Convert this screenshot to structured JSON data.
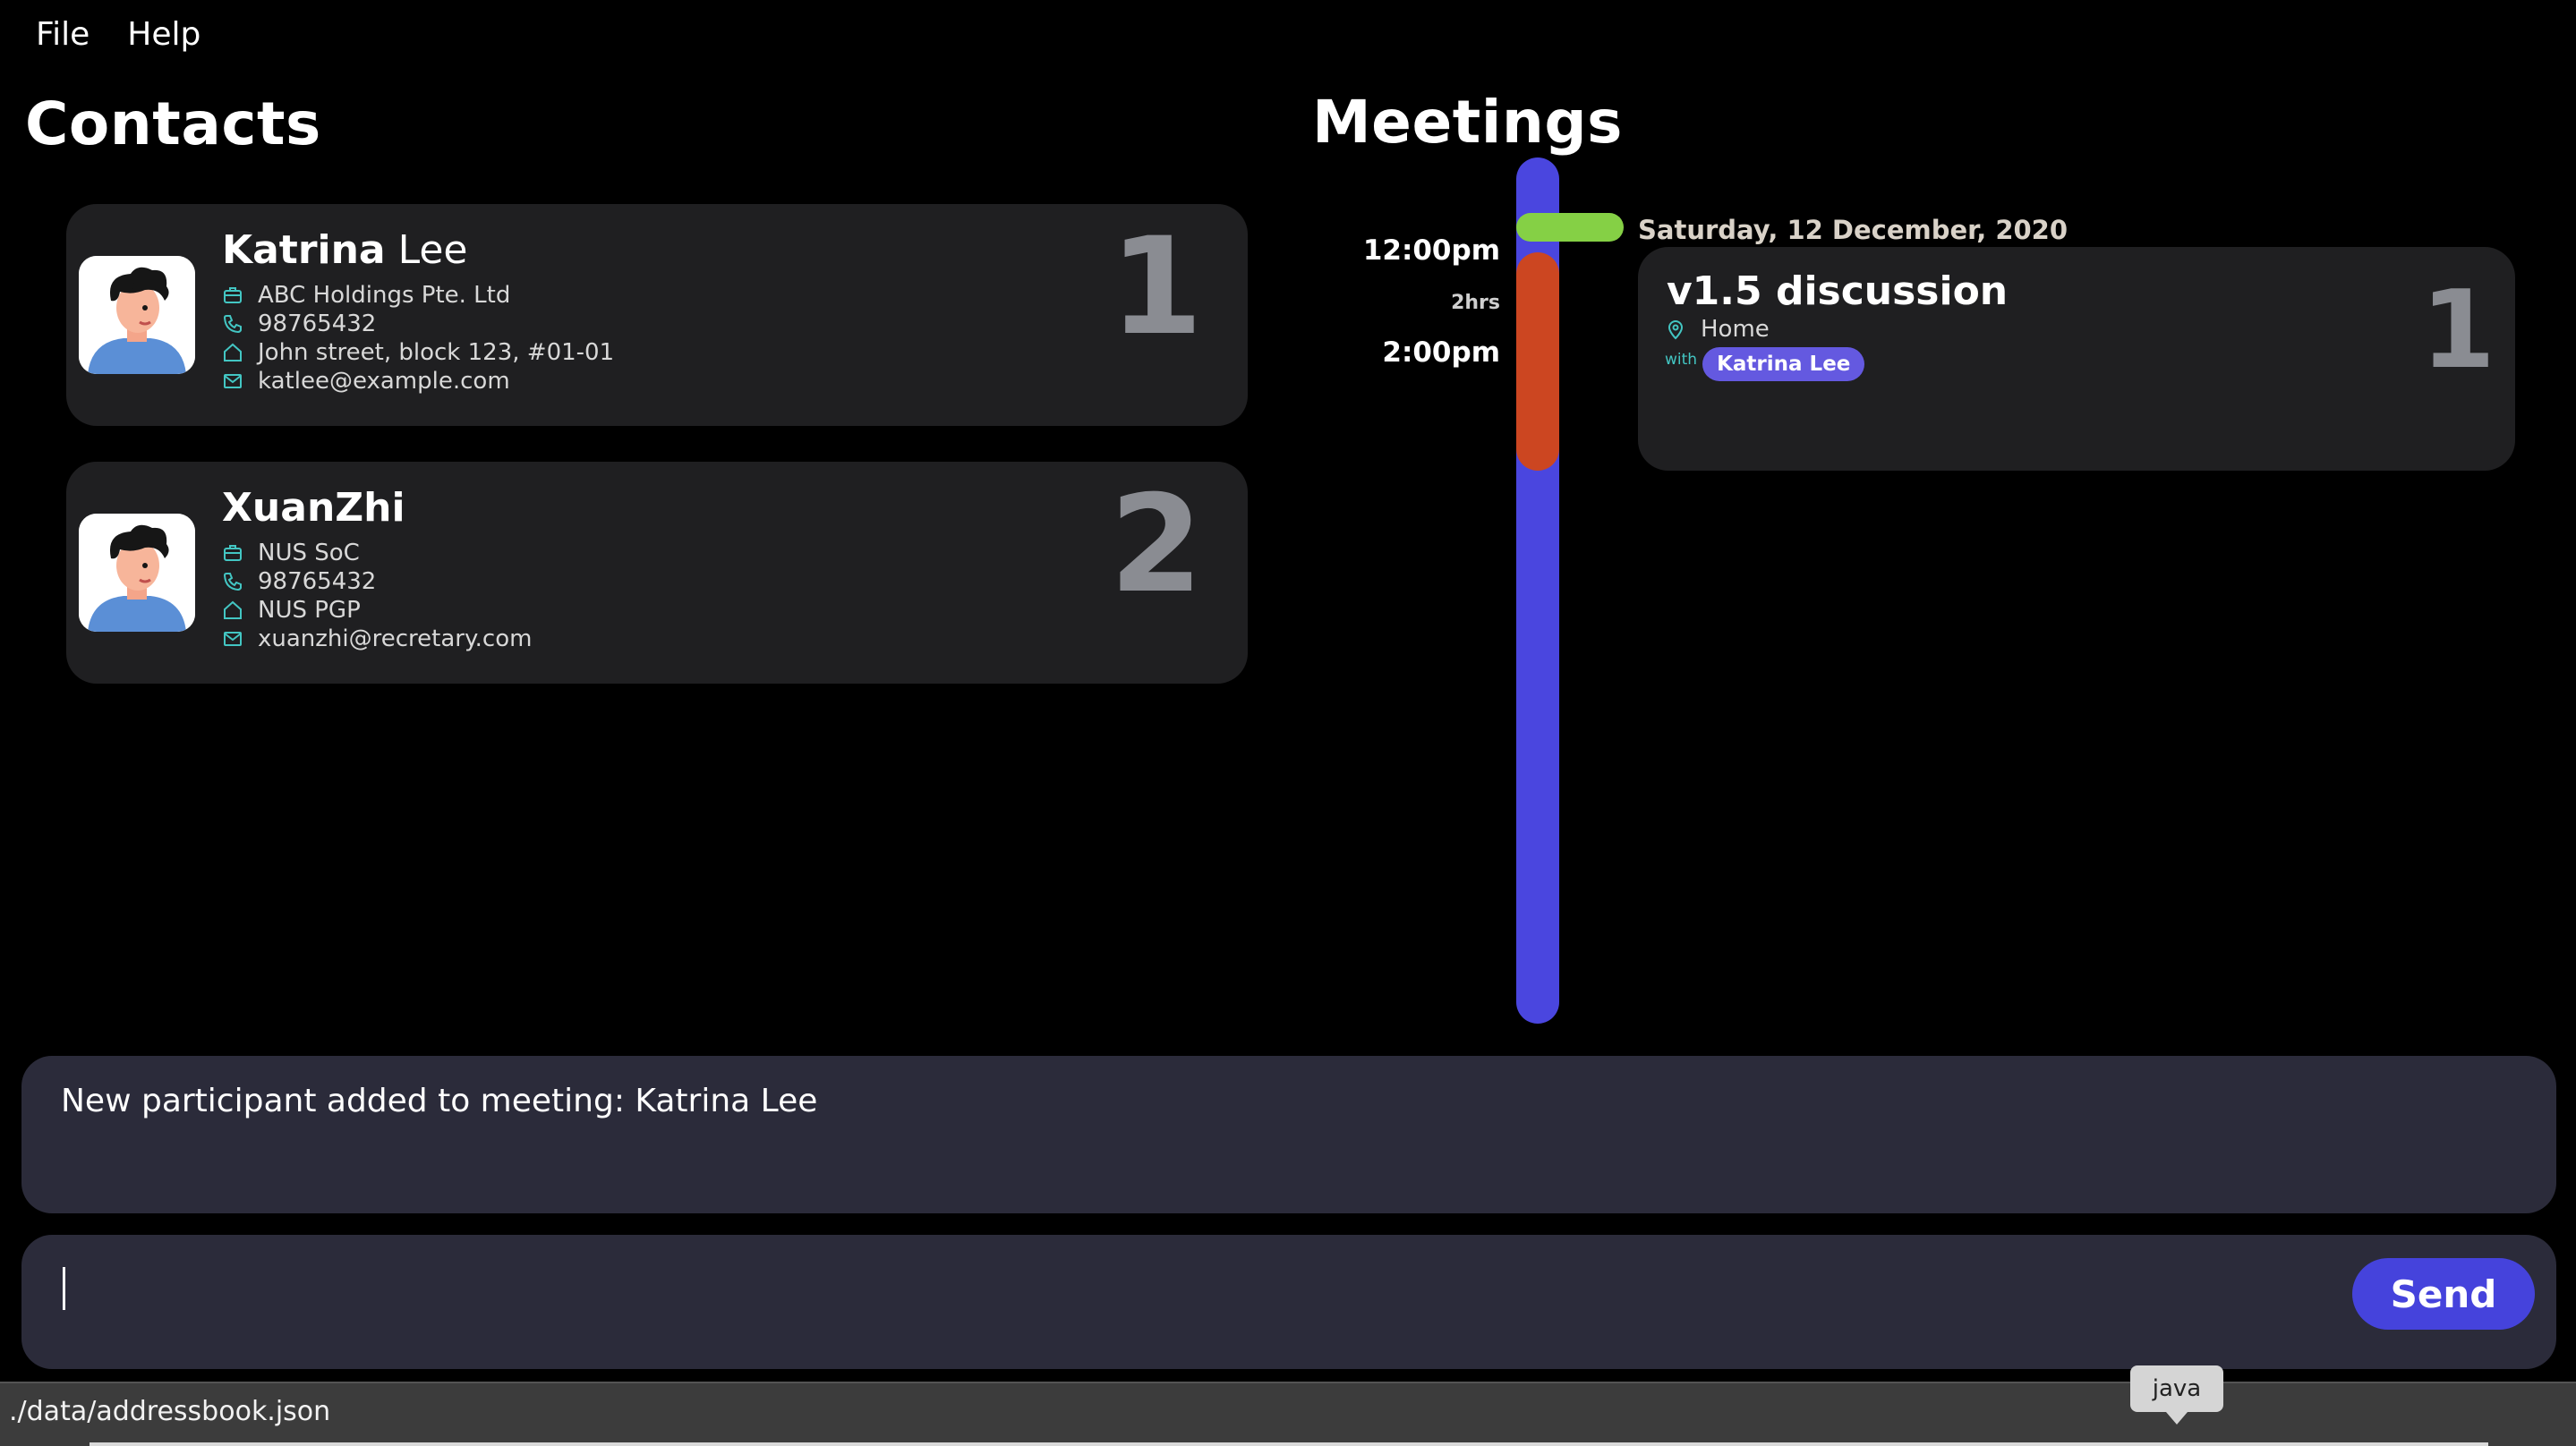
{
  "menu": {
    "file": "File",
    "help": "Help"
  },
  "contacts": {
    "heading": "Contacts",
    "items": [
      {
        "first_name": "Katrina",
        "last_name": "Lee",
        "company": "ABC Holdings Pte. Ltd",
        "phone": "98765432",
        "address": "John street, block 123, #01-01",
        "email": "katlee@example.com",
        "index": "1"
      },
      {
        "first_name": "XuanZhi",
        "last_name": "",
        "company": "NUS SoC",
        "phone": "98765432",
        "address": "NUS PGP",
        "email": "xuanzhi@recretary.com",
        "index": "2"
      }
    ]
  },
  "meetings": {
    "heading": "Meetings",
    "timeline": {
      "start": "12:00pm",
      "duration": "2hrs",
      "end": "2:00pm"
    },
    "date": "Saturday, 12 December, 2020",
    "items": [
      {
        "title": "v1.5 discussion",
        "location": "Home",
        "with_label": "with",
        "participants": [
          "Katrina Lee"
        ],
        "index": "1"
      }
    ]
  },
  "result": {
    "text": "New participant added to meeting: Katrina Lee"
  },
  "command": {
    "value": "",
    "send_label": "Send"
  },
  "status": {
    "path": "./data/addressbook.json"
  },
  "tooltip": {
    "text": "java"
  },
  "colors": {
    "background": "#000000",
    "card": "#1f1f21",
    "panel": "#2b2b3a",
    "accent": "#4543dc",
    "timeline": "#4a46df",
    "meeting_block": "#cc4621",
    "day_marker": "#85d045",
    "participant_tag": "#6459e0",
    "icon": "#43c6c3",
    "index_number": "#8a8c92"
  },
  "icons": [
    "briefcase-icon",
    "phone-icon",
    "home-icon",
    "email-icon",
    "location-pin-icon",
    "avatar-icon"
  ]
}
